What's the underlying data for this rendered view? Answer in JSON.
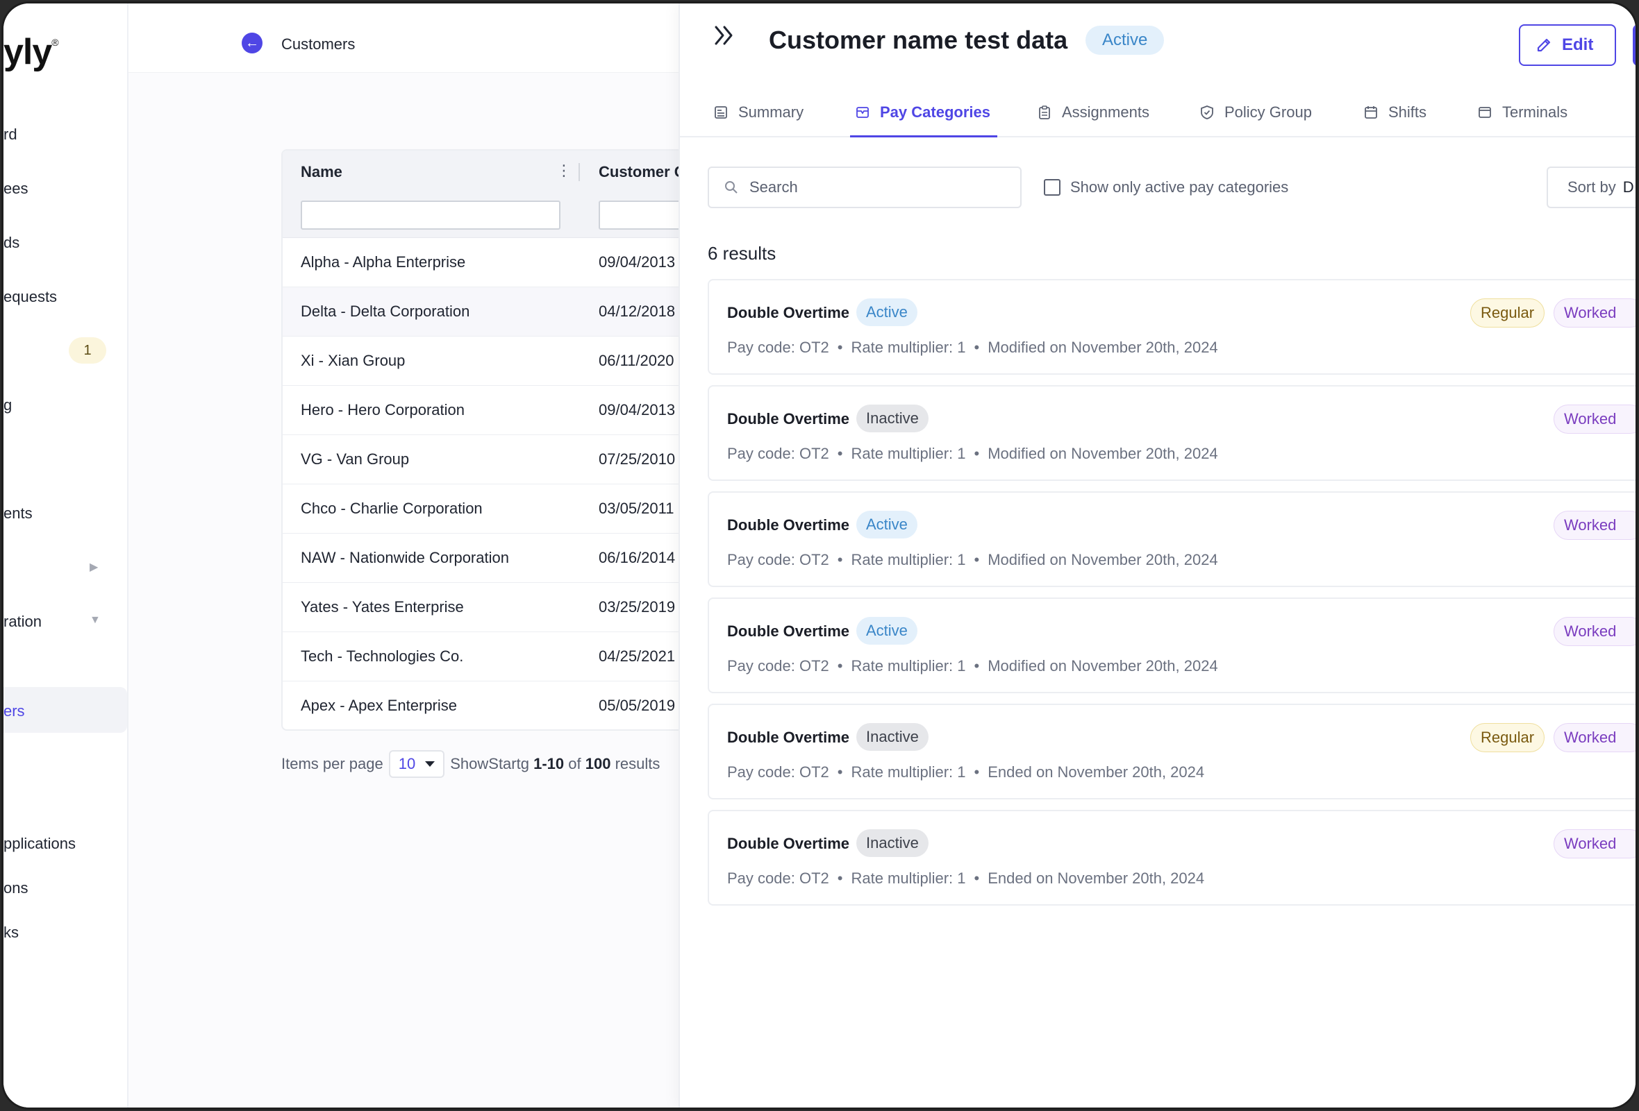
{
  "sidebar": {
    "logo": "yly",
    "logo_mark": "®",
    "items": [
      {
        "label": "rd"
      },
      {
        "label": "ees"
      },
      {
        "label": "ds"
      },
      {
        "label": "equests"
      },
      {
        "label": "g"
      },
      {
        "label": "ents"
      },
      {
        "label": "ration"
      },
      {
        "label": "ers"
      },
      {
        "label": "pplications"
      },
      {
        "label": "ons"
      },
      {
        "label": "ks"
      }
    ],
    "badge_count": "1"
  },
  "topbar": {
    "breadcrumb": "Customers"
  },
  "table": {
    "columns": [
      "Name",
      "Customer Code"
    ],
    "rows": [
      {
        "name": "Alpha - Alpha Enterprise",
        "code": "09/04/2013"
      },
      {
        "name": "Delta - Delta Corporation",
        "code": "04/12/2018"
      },
      {
        "name": "Xi - Xian Group",
        "code": "06/11/2020"
      },
      {
        "name": "Hero - Hero Corporation",
        "code": "09/04/2013"
      },
      {
        "name": "VG - Van Group",
        "code": "07/25/2010"
      },
      {
        "name": "Chco - Charlie Corporation",
        "code": "03/05/2011"
      },
      {
        "name": "NAW - Nationwide Corporation",
        "code": "06/16/2014"
      },
      {
        "name": "Yates - Yates Enterprise",
        "code": "03/25/2019"
      },
      {
        "name": "Tech - Technologies Co.",
        "code": "04/25/2021"
      },
      {
        "name": "Apex - Apex Enterprise",
        "code": "05/05/2019"
      }
    ]
  },
  "pager": {
    "label": "Items per page",
    "per_page": "10",
    "show_text": "ShowStartg",
    "range": "1-10",
    "of": "of",
    "total": "100",
    "suffix": "results"
  },
  "panel": {
    "title": "Customer name test data",
    "status": "Active",
    "edit_label": "Edit",
    "tabs": [
      {
        "label": "Summary"
      },
      {
        "label": "Pay Categories"
      },
      {
        "label": "Assignments"
      },
      {
        "label": "Policy Group"
      },
      {
        "label": "Shifts"
      },
      {
        "label": "Terminals"
      }
    ],
    "active_tab": "Pay Categories",
    "search_placeholder": "Search",
    "filter_label": "Show only active pay categories",
    "sort_label": "Sort by",
    "sort_value": "D",
    "results_count": "6 results",
    "cards": [
      {
        "title": "Double Overtime",
        "status": "Active",
        "pay_code": "Pay code: OT2",
        "rate": "Rate multiplier: 1",
        "date": "Modified on November 20th, 2024",
        "tags": [
          "Regular",
          "Worked"
        ]
      },
      {
        "title": "Double Overtime",
        "status": "Inactive",
        "pay_code": "Pay code: OT2",
        "rate": "Rate multiplier: 1",
        "date": "Modified on November 20th, 2024",
        "tags": [
          "Worked"
        ]
      },
      {
        "title": "Double Overtime",
        "status": "Active",
        "pay_code": "Pay code: OT2",
        "rate": "Rate multiplier: 1",
        "date": "Modified on November 20th, 2024",
        "tags": [
          "Worked"
        ]
      },
      {
        "title": "Double Overtime",
        "status": "Active",
        "pay_code": "Pay code: OT2",
        "rate": "Rate multiplier: 1",
        "date": "Modified on November 20th, 2024",
        "tags": [
          "Worked"
        ]
      },
      {
        "title": "Double Overtime",
        "status": "Inactive",
        "pay_code": "Pay code: OT2",
        "rate": "Rate multiplier: 1",
        "date": "Ended on November 20th, 2024",
        "tags": [
          "Regular",
          "Worked"
        ]
      },
      {
        "title": "Double Overtime",
        "status": "Inactive",
        "pay_code": "Pay code: OT2",
        "rate": "Rate multiplier: 1",
        "date": "Ended on November 20th, 2024",
        "tags": [
          "Worked"
        ]
      }
    ]
  },
  "colors": {
    "accent": "#4f46e5",
    "active_bg": "#e3f0fb",
    "active_fg": "#3a86c8",
    "regular_fg": "#7a5a10",
    "worked_fg": "#7a3cbf"
  }
}
